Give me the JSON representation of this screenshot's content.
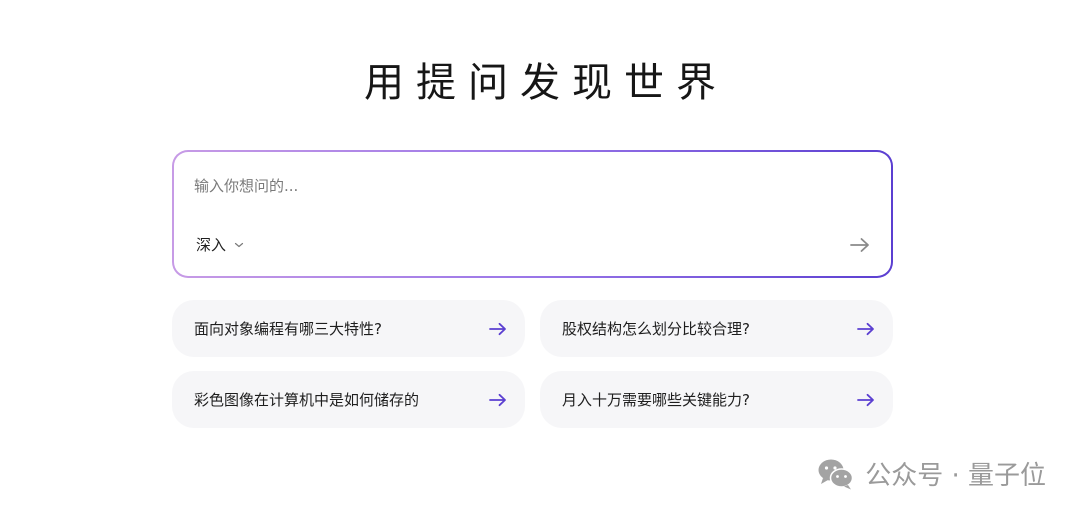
{
  "header": {
    "title": "用提问发现世界"
  },
  "search": {
    "placeholder": "输入你想问的...",
    "mode_label": "深入",
    "mode_icon": "chevron-down-icon",
    "submit_icon": "arrow-right-icon"
  },
  "suggestions": [
    {
      "label": "面向对象编程有哪三大特性?",
      "icon": "arrow-right-icon"
    },
    {
      "label": "股权结构怎么划分比较合理?",
      "icon": "arrow-right-icon"
    },
    {
      "label": "彩色图像在计算机中是如何储存的",
      "icon": "arrow-right-icon"
    },
    {
      "label": "月入十万需要哪些关键能力?",
      "icon": "arrow-right-icon"
    }
  ],
  "watermark": {
    "text": "公众号 · 量子位",
    "icon": "wechat-icon"
  },
  "colors": {
    "accent": "#5b3fd1",
    "gradient_start": "#c79be6",
    "suggestion_bg": "#f6f6f8"
  }
}
